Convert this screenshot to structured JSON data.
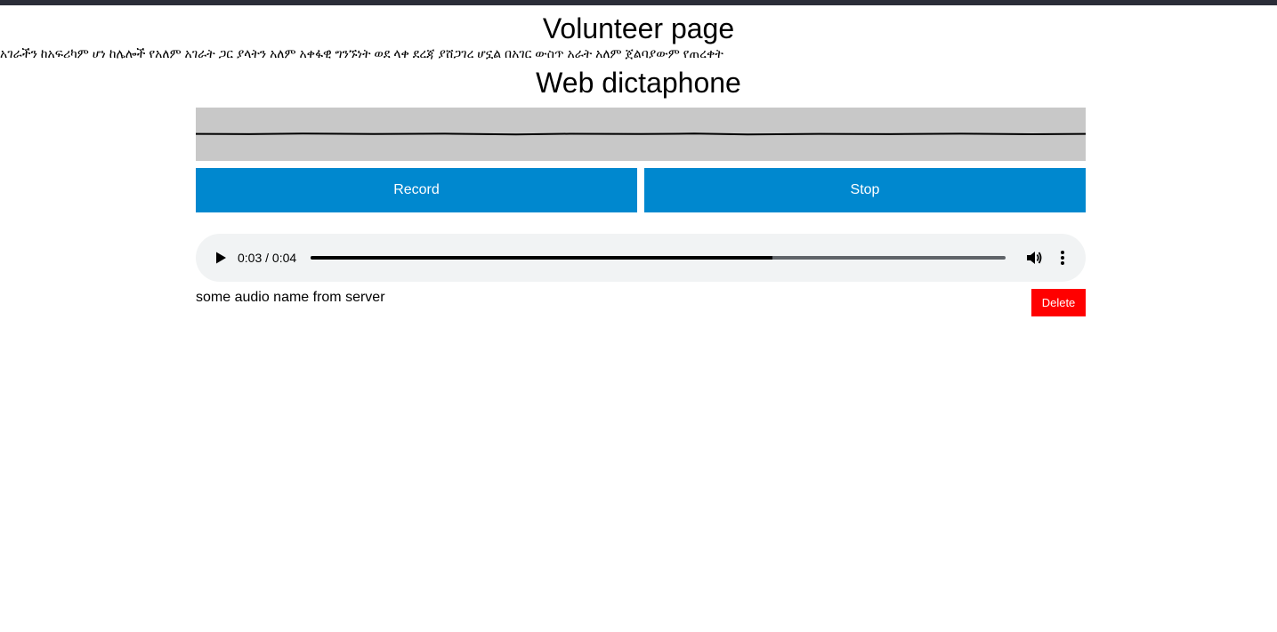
{
  "page": {
    "title": "Volunteer page",
    "intro_text": "አገራችን ከአፍሪካም ሆነ ከሌሎች የአለም አገራት ጋር ያላትን አለም አቀፋዊ ግንኙነት ወደ ላቀ ደረጃ ያሸጋገረ ሆኗል በአገር ውስጥ አራት አለም ጀልባያውም የጠረቀት"
  },
  "dictaphone": {
    "title": "Web dictaphone",
    "record_label": "Record",
    "stop_label": "Stop",
    "accent_color": "#0088cf",
    "wave_background": "#c8c8c8"
  },
  "clips": [
    {
      "player": {
        "current_time": "0:03",
        "duration": "0:04",
        "time_display": "0:03 / 0:04",
        "progress_fraction": 0.664,
        "icons": {
          "play": "play-icon",
          "volume": "volume-icon",
          "more": "more-vert-icon"
        }
      },
      "name": "some audio name from server",
      "delete_label": "Delete",
      "delete_color": "#ff0000"
    }
  ]
}
